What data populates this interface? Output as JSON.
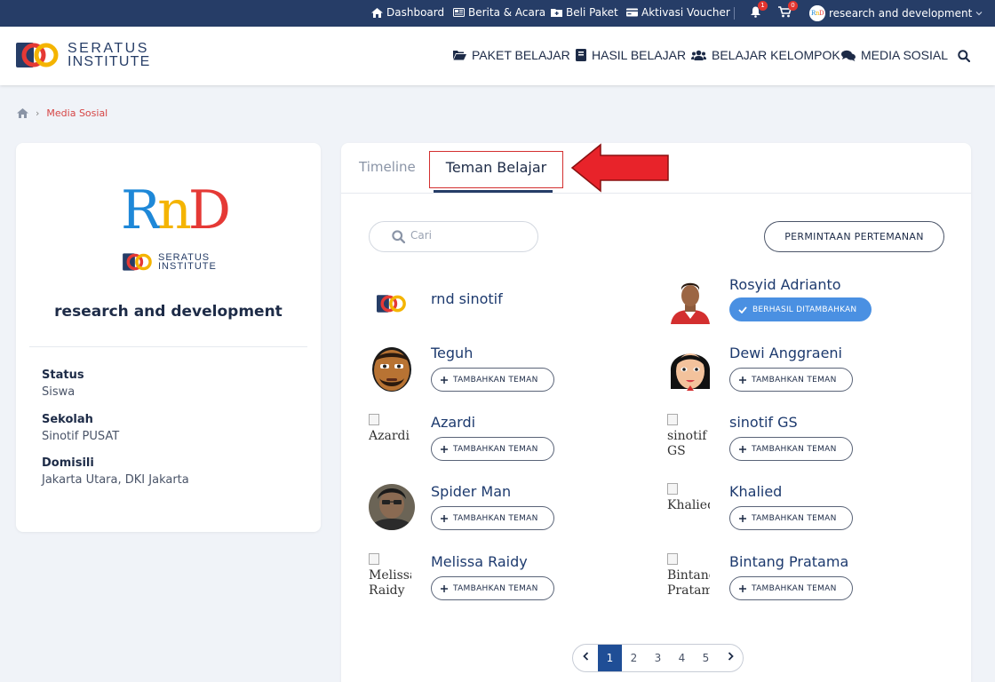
{
  "topbar": {
    "dashboard": "Dashboard",
    "berita": "Berita & Acara",
    "beli": "Beli Paket",
    "aktivasi": "Aktivasi Voucher",
    "notif_count": "1",
    "cart_count": "0",
    "user": "research and development"
  },
  "brand": {
    "line1": "SERATUS",
    "line2": "INSTITUTE"
  },
  "nav": {
    "paket": "PAKET BELAJAR",
    "hasil": "HASIL BELAJAR",
    "kelompok": "BELAJAR KELOMPOK",
    "media": "MEDIA SOSIAL"
  },
  "breadcrumb": {
    "current": "Media Sosial"
  },
  "profile": {
    "logo_letters": [
      "R",
      "n",
      "D"
    ],
    "brand_line1": "SERATUS",
    "brand_line2": "INSTITUTE",
    "name": "research and development",
    "status_label": "Status",
    "status_value": "Siswa",
    "sekolah_label": "Sekolah",
    "sekolah_value": "Sinotif PUSAT",
    "domisili_label": "Domisili",
    "domisili_value": "Jakarta Utara, DKI Jakarta"
  },
  "tabs": {
    "timeline": "Timeline",
    "teman": "Teman Belajar"
  },
  "search": {
    "placeholder": "Cari"
  },
  "request_button": "PERMINTAAN PERTEMANAN",
  "add_label": "TAMBAHKAN TEMAN",
  "added_label": "BERHASIL DITAMBAHKAN",
  "friends": [
    {
      "name": "rnd sinotif"
    },
    {
      "name": "Rosyid Adrianto"
    },
    {
      "name": "Teguh"
    },
    {
      "name": "Dewi Anggraeni"
    },
    {
      "name": "Azardi",
      "alt": "Azardi"
    },
    {
      "name": "sinotif GS",
      "alt": "sinotif GS"
    },
    {
      "name": "Spider Man"
    },
    {
      "name": "Khalied",
      "alt": "Khalied"
    },
    {
      "name": "Melissa Raidy",
      "alt": "Melissa Raidy"
    },
    {
      "name": "Bintang Pratama",
      "alt": "Bintang Pratama"
    }
  ],
  "pagination": {
    "pages": [
      "1",
      "2",
      "3",
      "4",
      "5"
    ],
    "current": "1"
  },
  "colors": {
    "navy": "#263d67",
    "accent_red": "#d64545",
    "added_blue": "#4a90e2",
    "active_page": "#1f4e96"
  }
}
